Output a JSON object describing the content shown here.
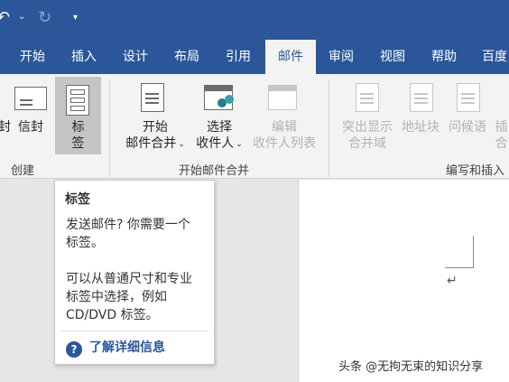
{
  "qat": {
    "undo_glyph": "↶",
    "dropdown_glyph": "⌄",
    "redo_glyph": "↻",
    "customize_glyph": "▾"
  },
  "tabs": [
    {
      "label": "开始"
    },
    {
      "label": "插入"
    },
    {
      "label": "设计"
    },
    {
      "label": "布局"
    },
    {
      "label": "引用"
    },
    {
      "label": "邮件",
      "active": true
    },
    {
      "label": "审阅"
    },
    {
      "label": "视图"
    },
    {
      "label": "帮助"
    },
    {
      "label": "百度"
    }
  ],
  "ribbon": {
    "create": {
      "envelope_label": "封",
      "envelopes_label": "信封",
      "labels_line1": "标",
      "labels_line2": "签",
      "group_label": "创建"
    },
    "start_merge": {
      "start_line1": "开始",
      "start_line2": "邮件合并",
      "select_line1": "选择",
      "select_line2": "收件人",
      "edit_line1": "编辑",
      "edit_line2": "收件人列表",
      "group_label": "开始邮件合并"
    },
    "write_insert": {
      "highlight_line1": "突出显示",
      "highlight_line2": "合并域",
      "address_block": "地址块",
      "greeting_line": "问候语",
      "insert_line1": "插",
      "insert_line2": "合",
      "group_label": "编写和插入"
    }
  },
  "tooltip": {
    "title": "标签",
    "line1": "发送邮件? 你需要一个",
    "line2": "标签。",
    "line3": "可以从普通尺寸和专业",
    "line4": "标签中选择，例如",
    "line5": "CD/DVD 标签。",
    "help_icon": "?",
    "help_link": "了解详细信息"
  },
  "document": {
    "return_mark": "↵"
  },
  "watermark": "头条 @无拘无束的知识分享",
  "colors": {
    "accent": "#2b579a",
    "ribbon_bg": "#f3f3f3",
    "pressed": "#c5c5c5"
  }
}
